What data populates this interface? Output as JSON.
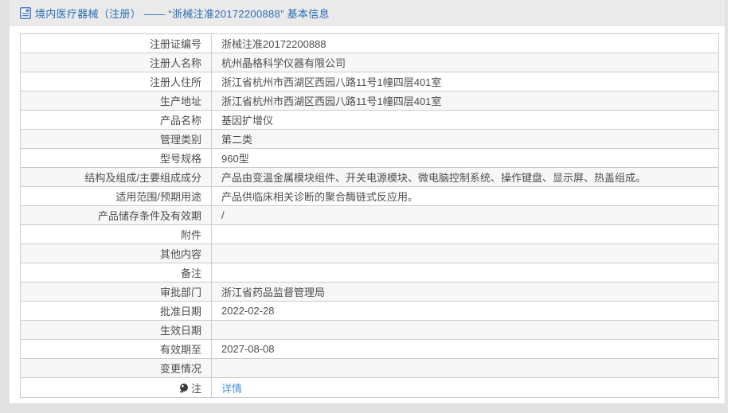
{
  "header": {
    "title": "境内医疗器械（注册） —— “浙械注准20172200888” 基本信息",
    "icon": "document-icon"
  },
  "colors": {
    "accent_blue": "#2a6cb5",
    "link_blue": "#4a90d9",
    "row_alt_bg": "#f7f7f7",
    "border": "#cccccc",
    "page_bg": "#e2e2e2",
    "text": "#4d4d4d"
  },
  "table": {
    "rows": [
      {
        "label": "注册证编号",
        "value": "浙械注准20172200888"
      },
      {
        "label": "注册人名称",
        "value": "杭州晶格科学仪器有限公司"
      },
      {
        "label": "注册人住所",
        "value": "浙江省杭州市西湖区西园八路11号1幢四层401室"
      },
      {
        "label": "生产地址",
        "value": "浙江省杭州市西湖区西园八路11号1幢四层401室"
      },
      {
        "label": "产品名称",
        "value": "基因扩增仪"
      },
      {
        "label": "管理类别",
        "value": "第二类"
      },
      {
        "label": "型号规格",
        "value": "960型"
      },
      {
        "label": "结构及组成/主要组成成分",
        "value": "产品由变温金属模块组件、开关电源模块、微电脑控制系统、操作键盘、显示屏、热盖组成。"
      },
      {
        "label": "适用范围/预期用途",
        "value": "产品供临床相关诊断的聚合酶链式反应用。"
      },
      {
        "label": "产品储存条件及有效期",
        "value": "/"
      },
      {
        "label": "附件",
        "value": ""
      },
      {
        "label": "其他内容",
        "value": ""
      },
      {
        "label": "备注",
        "value": ""
      },
      {
        "label": "审批部门",
        "value": "浙江省药品监督管理局"
      },
      {
        "label": "批准日期",
        "value": "2022-02-28"
      },
      {
        "label": "生效日期",
        "value": ""
      },
      {
        "label": "有效期至",
        "value": "2027-08-08"
      },
      {
        "label": "变更情况",
        "value": ""
      },
      {
        "label": "注",
        "value": "详情",
        "link": true,
        "icon": "note-icon"
      }
    ]
  }
}
